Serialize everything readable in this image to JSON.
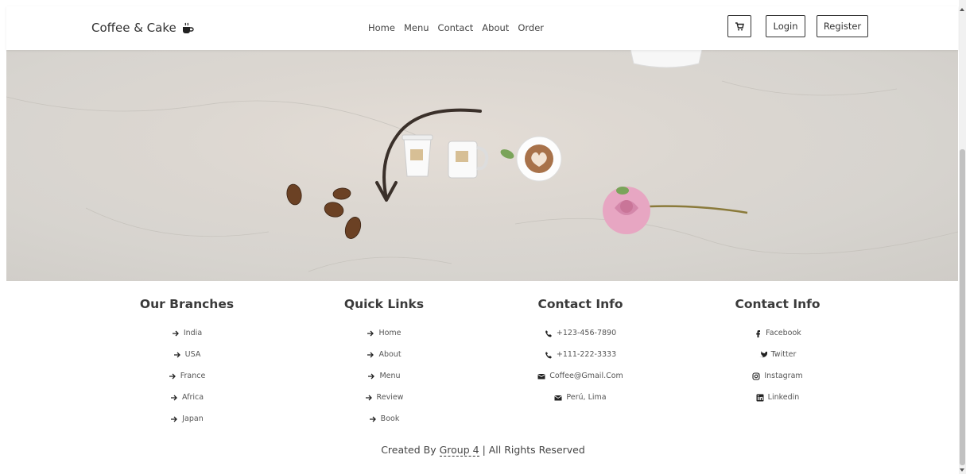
{
  "header": {
    "brand": "Coffee & Cake",
    "nav": [
      "Home",
      "Menu",
      "Contact",
      "About",
      "Order"
    ],
    "login_label": "Login",
    "register_label": "Register"
  },
  "footer": {
    "columns": [
      {
        "title": "Our Branches",
        "icon": "arrow-right-icon",
        "items": [
          "India",
          "USA",
          "France",
          "Africa",
          "Japan"
        ]
      },
      {
        "title": "Quick Links",
        "icon": "arrow-right-icon",
        "items": [
          "Home",
          "About",
          "Menu",
          "Review",
          "Book"
        ]
      },
      {
        "title": "Contact Info",
        "items": [
          {
            "icon": "phone-icon",
            "label": "+123-456-7890"
          },
          {
            "icon": "phone-icon",
            "label": "+111-222-3333"
          },
          {
            "icon": "envelope-icon",
            "label": "Coffee@Gmail.Com"
          },
          {
            "icon": "envelope-icon",
            "label": "Perú, Lima"
          }
        ]
      },
      {
        "title": "Contact Info",
        "items": [
          {
            "icon": "facebook-icon",
            "label": "Facebook"
          },
          {
            "icon": "twitter-icon",
            "label": "Twitter"
          },
          {
            "icon": "instagram-icon",
            "label": "Instagram"
          },
          {
            "icon": "linkedin-icon",
            "label": "Linkedin"
          }
        ]
      }
    ],
    "credit_prefix": "Created By",
    "credit_group": "Group 4",
    "credit_suffix": "| All Rights Reserved"
  },
  "colors": {
    "text": "#333333",
    "hero_bg": "#dcd7d1",
    "rose": "#e7a6c2"
  }
}
